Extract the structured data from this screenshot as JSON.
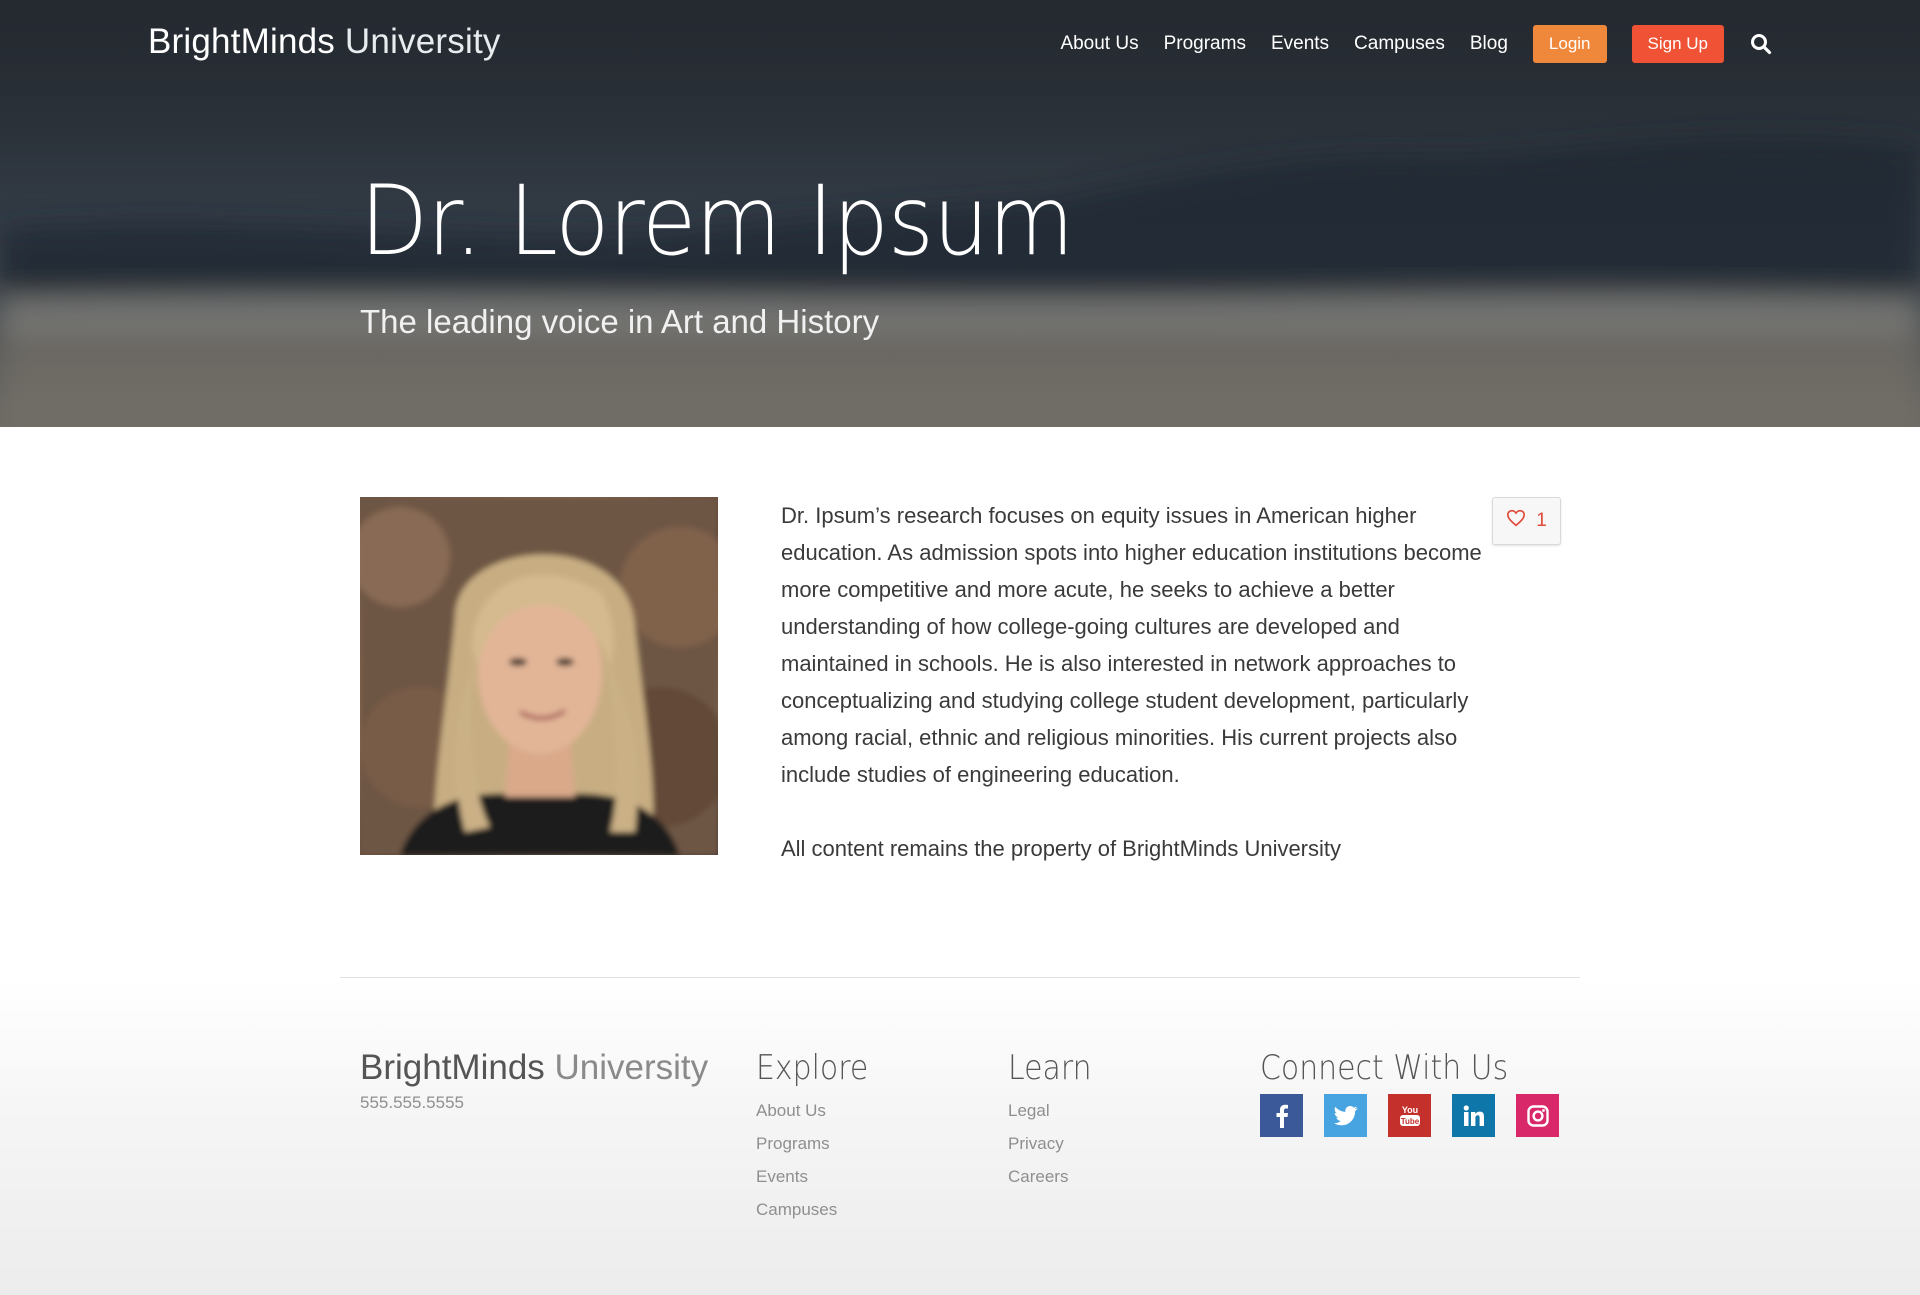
{
  "header": {
    "logo_bold": "BrightMinds",
    "logo_light": " University",
    "nav": {
      "about": "About Us",
      "programs": "Programs",
      "events": "Events",
      "campuses": "Campuses",
      "blog": "Blog",
      "login": "Login",
      "signup": "Sign Up"
    },
    "search_icon": "search-icon"
  },
  "hero": {
    "title": "Dr. Lorem Ipsum",
    "subtitle": "The leading voice in Art and History"
  },
  "profile": {
    "bio": "Dr. Ipsum’s research focuses on equity issues in American higher education. As admission spots into higher education institutions become more competitive and more acute, he seeks to achieve a better understanding of how college-going cultures are developed and maintained in schools. He is also interested in network approaches to conceptualizing and studying college student development, particularly among racial, ethnic and religious minorities. His current projects also include studies of engineering education.",
    "copyright": "All content remains the property of BrightMinds University",
    "likes": "1",
    "like_icon": "heart-icon"
  },
  "footer": {
    "brand_bold": "BrightMinds",
    "brand_light": " University",
    "phone": "555.555.5555",
    "explore": {
      "title": "Explore",
      "links": [
        "About Us",
        "Programs",
        "Events",
        "Campuses"
      ]
    },
    "learn": {
      "title": "Learn",
      "links": [
        "Legal",
        "Privacy",
        "Careers"
      ]
    },
    "connect": {
      "title": "Connect With Us",
      "social": [
        "facebook-icon",
        "twitter-icon",
        "youtube-icon",
        "linkedin-icon",
        "instagram-icon"
      ]
    }
  },
  "colors": {
    "login": "#f0883c",
    "signup": "#ef5235",
    "facebook": "#3b5998",
    "twitter": "#48a4e0",
    "youtube": "#c4302b",
    "linkedin": "#0e76a8",
    "instagram": "#d8286a",
    "like": "#e04a3b"
  }
}
